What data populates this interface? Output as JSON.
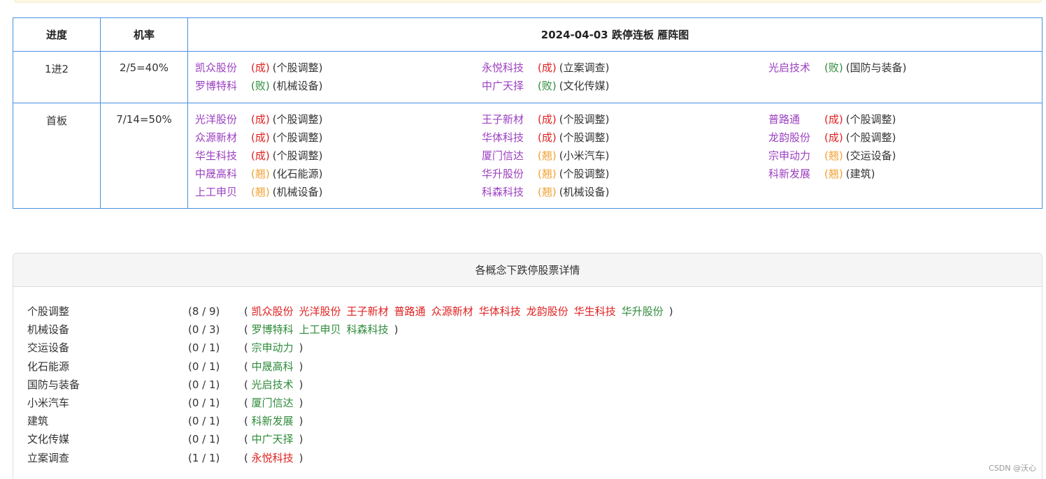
{
  "ladder": {
    "header": {
      "progress": "进度",
      "rate": "机率",
      "title": "2024-04-03 跌停连板 雁阵图"
    },
    "rows": [
      {
        "progress": "1进2",
        "rate": "2/5=40%",
        "stocks": [
          {
            "name": "凯众股份",
            "status": "(成)",
            "kind": "ok",
            "tag": "(个股调整)"
          },
          {
            "name": "永悦科技",
            "status": "(成)",
            "kind": "ok",
            "tag": "(立案调查)"
          },
          {
            "name": "光启技术",
            "status": "(败)",
            "kind": "fail",
            "tag": "(国防与装备)"
          },
          {
            "name": "罗博特科",
            "status": "(败)",
            "kind": "fail",
            "tag": "(机械设备)"
          },
          {
            "name": "中广天择",
            "status": "(败)",
            "kind": "fail",
            "tag": "(文化传媒)"
          }
        ]
      },
      {
        "progress": "首板",
        "rate": "7/14=50%",
        "stocks": [
          {
            "name": "光洋股份",
            "status": "(成)",
            "kind": "ok",
            "tag": "(个股调整)"
          },
          {
            "name": "王子新材",
            "status": "(成)",
            "kind": "ok",
            "tag": "(个股调整)"
          },
          {
            "name": "普路通",
            "status": "(成)",
            "kind": "ok",
            "tag": "(个股调整)"
          },
          {
            "name": "众源新材",
            "status": "(成)",
            "kind": "ok",
            "tag": "(个股调整)"
          },
          {
            "name": "华体科技",
            "status": "(成)",
            "kind": "ok",
            "tag": "(个股调整)"
          },
          {
            "name": "龙韵股份",
            "status": "(成)",
            "kind": "ok",
            "tag": "(个股调整)"
          },
          {
            "name": "华生科技",
            "status": "(成)",
            "kind": "ok",
            "tag": "(个股调整)"
          },
          {
            "name": "厦门信达",
            "status": "(翘)",
            "kind": "pre",
            "tag": "(小米汽车)"
          },
          {
            "name": "宗申动力",
            "status": "(翘)",
            "kind": "pre",
            "tag": "(交运设备)"
          },
          {
            "name": "中晟高科",
            "status": "(翘)",
            "kind": "pre",
            "tag": "(化石能源)"
          },
          {
            "name": "华升股份",
            "status": "(翘)",
            "kind": "pre",
            "tag": "(个股调整)"
          },
          {
            "name": "科新发展",
            "status": "(翘)",
            "kind": "pre",
            "tag": "(建筑)"
          },
          {
            "name": "上工申贝",
            "status": "(翘)",
            "kind": "pre",
            "tag": "(机械设备)"
          },
          {
            "name": "科森科技",
            "status": "(翘)",
            "kind": "pre",
            "tag": "(机械设备)"
          }
        ]
      }
    ]
  },
  "details": {
    "title": "各概念下跌停股票详情",
    "rows": [
      {
        "concept": "个股调整",
        "count": "(8 / 9)",
        "stocks": [
          {
            "name": "凯众股份",
            "kind": "ok"
          },
          {
            "name": "光洋股份",
            "kind": "ok"
          },
          {
            "name": "王子新材",
            "kind": "ok"
          },
          {
            "name": "普路通",
            "kind": "ok"
          },
          {
            "name": "众源新材",
            "kind": "ok"
          },
          {
            "name": "华体科技",
            "kind": "ok"
          },
          {
            "name": "龙韵股份",
            "kind": "ok"
          },
          {
            "name": "华生科技",
            "kind": "ok"
          },
          {
            "name": "华升股份",
            "kind": "fail"
          }
        ]
      },
      {
        "concept": "机械设备",
        "count": "(0 / 3)",
        "stocks": [
          {
            "name": "罗博特科",
            "kind": "fail"
          },
          {
            "name": "上工申贝",
            "kind": "fail"
          },
          {
            "name": "科森科技",
            "kind": "fail"
          }
        ]
      },
      {
        "concept": "交运设备",
        "count": "(0 / 1)",
        "stocks": [
          {
            "name": "宗申动力",
            "kind": "fail"
          }
        ]
      },
      {
        "concept": "化石能源",
        "count": "(0 / 1)",
        "stocks": [
          {
            "name": "中晟高科",
            "kind": "fail"
          }
        ]
      },
      {
        "concept": "国防与装备",
        "count": "(0 / 1)",
        "stocks": [
          {
            "name": "光启技术",
            "kind": "fail"
          }
        ]
      },
      {
        "concept": "小米汽车",
        "count": "(0 / 1)",
        "stocks": [
          {
            "name": "厦门信达",
            "kind": "fail"
          }
        ]
      },
      {
        "concept": "建筑",
        "count": "(0 / 1)",
        "stocks": [
          {
            "name": "科新发展",
            "kind": "fail"
          }
        ]
      },
      {
        "concept": "文化传媒",
        "count": "(0 / 1)",
        "stocks": [
          {
            "name": "中广天择",
            "kind": "fail"
          }
        ]
      },
      {
        "concept": "立案调查",
        "count": "(1 / 1)",
        "stocks": [
          {
            "name": "永悦科技",
            "kind": "ok"
          }
        ]
      }
    ]
  },
  "watermark": "CSDN @沃心",
  "colors": {
    "stock_name": "#9b3fc0",
    "success": "#e02020",
    "fail": "#2e8b3a",
    "pending": "#f0a030",
    "border": "#4a90e2"
  }
}
